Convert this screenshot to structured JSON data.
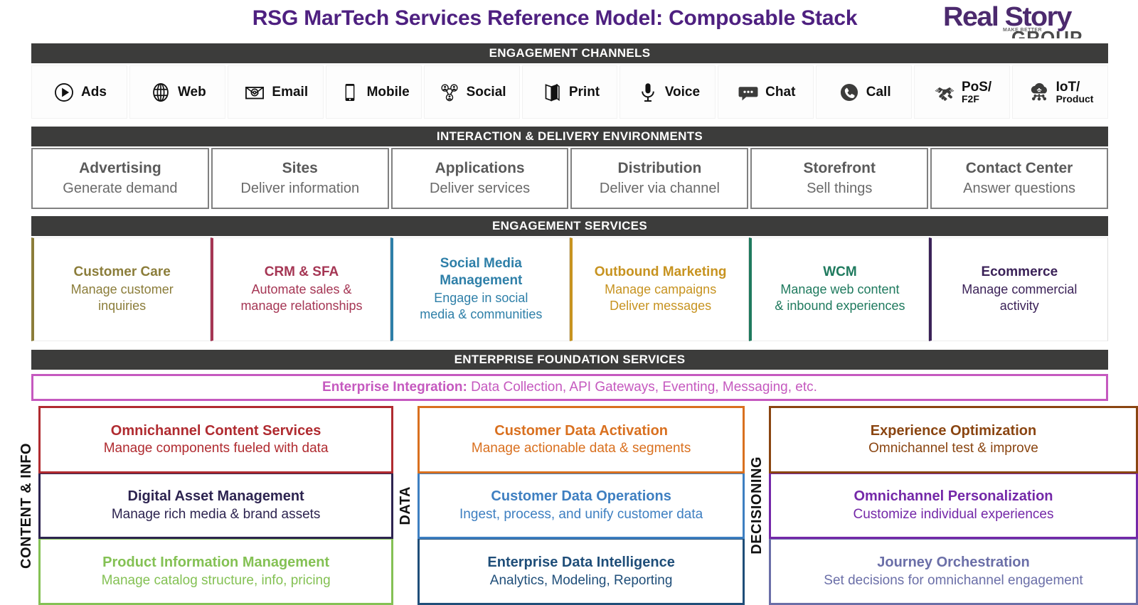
{
  "title": "RSG MarTech Services Reference Model: Composable Stack",
  "logo": {
    "main": "Real Story",
    "sub": "GROUP",
    "tiny": "MAKE BETTER"
  },
  "colors": {
    "title_purple": "#4e2080",
    "band_dark": "#3c3c3b",
    "integration_magenta": "#c559bf"
  },
  "bands": {
    "channels": "ENGAGEMENT CHANNELS",
    "interaction": "INTERACTION & DELIVERY ENVIRONMENTS",
    "engagement": "ENGAGEMENT SERVICES",
    "foundation": "ENTERPRISE FOUNDATION SERVICES"
  },
  "channels": [
    {
      "label": "Ads",
      "icon": "play-circle-icon"
    },
    {
      "label": "Web",
      "icon": "globe-icon"
    },
    {
      "label": "Email",
      "icon": "envelope-at-icon"
    },
    {
      "label": "Mobile",
      "icon": "smartphone-icon"
    },
    {
      "label": "Social",
      "icon": "social-network-icon"
    },
    {
      "label": "Print",
      "icon": "brochure-icon"
    },
    {
      "label": "Voice",
      "icon": "microphone-icon"
    },
    {
      "label": "Chat",
      "icon": "chat-bubble-icon"
    },
    {
      "label": "Call",
      "icon": "phone-icon"
    },
    {
      "label": "PoS/",
      "label2": "F2F",
      "icon": "handshake-icon"
    },
    {
      "label": "IoT/",
      "label2": "Product",
      "icon": "iot-cloud-icon"
    }
  ],
  "interaction_environments": [
    {
      "title": "Advertising",
      "desc": "Generate demand"
    },
    {
      "title": "Sites",
      "desc": "Deliver information"
    },
    {
      "title": "Applications",
      "desc": "Deliver services"
    },
    {
      "title": "Distribution",
      "desc": "Deliver via channel"
    },
    {
      "title": "Storefront",
      "desc": "Sell things"
    },
    {
      "title": "Contact Center",
      "desc": "Answer questions"
    }
  ],
  "engagement_services": [
    {
      "title": "Customer Care",
      "desc": "Manage customer inquiries",
      "color": "#8b7d3a"
    },
    {
      "title": "CRM & SFA",
      "desc": "Automate sales & manage relationships",
      "color": "#a53654"
    },
    {
      "title": "Social Media Management",
      "desc": "Engage in social media & communities",
      "color": "#2e7fa8"
    },
    {
      "title": "Outbound Marketing",
      "desc": "Manage campaigns Deliver messages",
      "color": "#c79320"
    },
    {
      "title": "WCM",
      "desc": "Manage web content & inbound experiences",
      "color": "#1f7a5e"
    },
    {
      "title": "Ecommerce",
      "desc": "Manage commercial activity",
      "color": "#3b2258"
    }
  ],
  "engagement_services_lines": [
    {
      "title": [
        "Customer Care"
      ],
      "desc": [
        "Manage customer",
        "inquiries"
      ]
    },
    {
      "title": [
        "CRM & SFA"
      ],
      "desc": [
        "Automate sales &",
        "manage relationships"
      ]
    },
    {
      "title": [
        "Social Media",
        "Management"
      ],
      "desc": [
        "Engage in social",
        "media & communities"
      ]
    },
    {
      "title": [
        "Outbound Marketing"
      ],
      "desc": [
        "Manage campaigns",
        "Deliver messages"
      ]
    },
    {
      "title": [
        "WCM"
      ],
      "desc": [
        "Manage web content",
        "& inbound experiences"
      ]
    },
    {
      "title": [
        "Ecommerce"
      ],
      "desc": [
        "Manage commercial",
        "activity"
      ]
    }
  ],
  "integration": {
    "label": "Enterprise Integration:",
    "items": " Data Collection, API Gateways, Eventing, Messaging, etc."
  },
  "bottom_columns": [
    {
      "axis_label": "CONTENT & INFO",
      "boxes": [
        {
          "title": "Omnichannel Content Services",
          "desc": "Manage components fueled with data",
          "color": "#b02b30"
        },
        {
          "title": "Digital Asset Management",
          "desc": "Manage rich media & brand assets",
          "color": "#2d2450"
        },
        {
          "title": "Product Information Management",
          "desc": "Manage catalog structure, info, pricing",
          "color": "#84c154"
        }
      ]
    },
    {
      "axis_label": "DATA",
      "boxes": [
        {
          "title": "Customer Data Activation",
          "desc": "Manage actionable data & segments",
          "color": "#d9701f"
        },
        {
          "title": "Customer Data Operations",
          "desc": "Ingest, process, and unify customer data",
          "color": "#3e7fc1"
        },
        {
          "title": "Enterprise Data Intelligence",
          "desc": "Analytics, Modeling, Reporting",
          "color": "#1f4e79"
        }
      ]
    },
    {
      "axis_label": "DECISIONING",
      "boxes": [
        {
          "title": "Experience Optimization",
          "desc": "Omnichannel test & improve",
          "color": "#8a4511"
        },
        {
          "title": "Omnichannel Personalization",
          "desc": "Customize individual experiences",
          "color": "#7428a8"
        },
        {
          "title": "Journey Orchestration",
          "desc": "Set decisions for omnichannel engagement",
          "color": "#6b6fa8"
        }
      ]
    }
  ]
}
